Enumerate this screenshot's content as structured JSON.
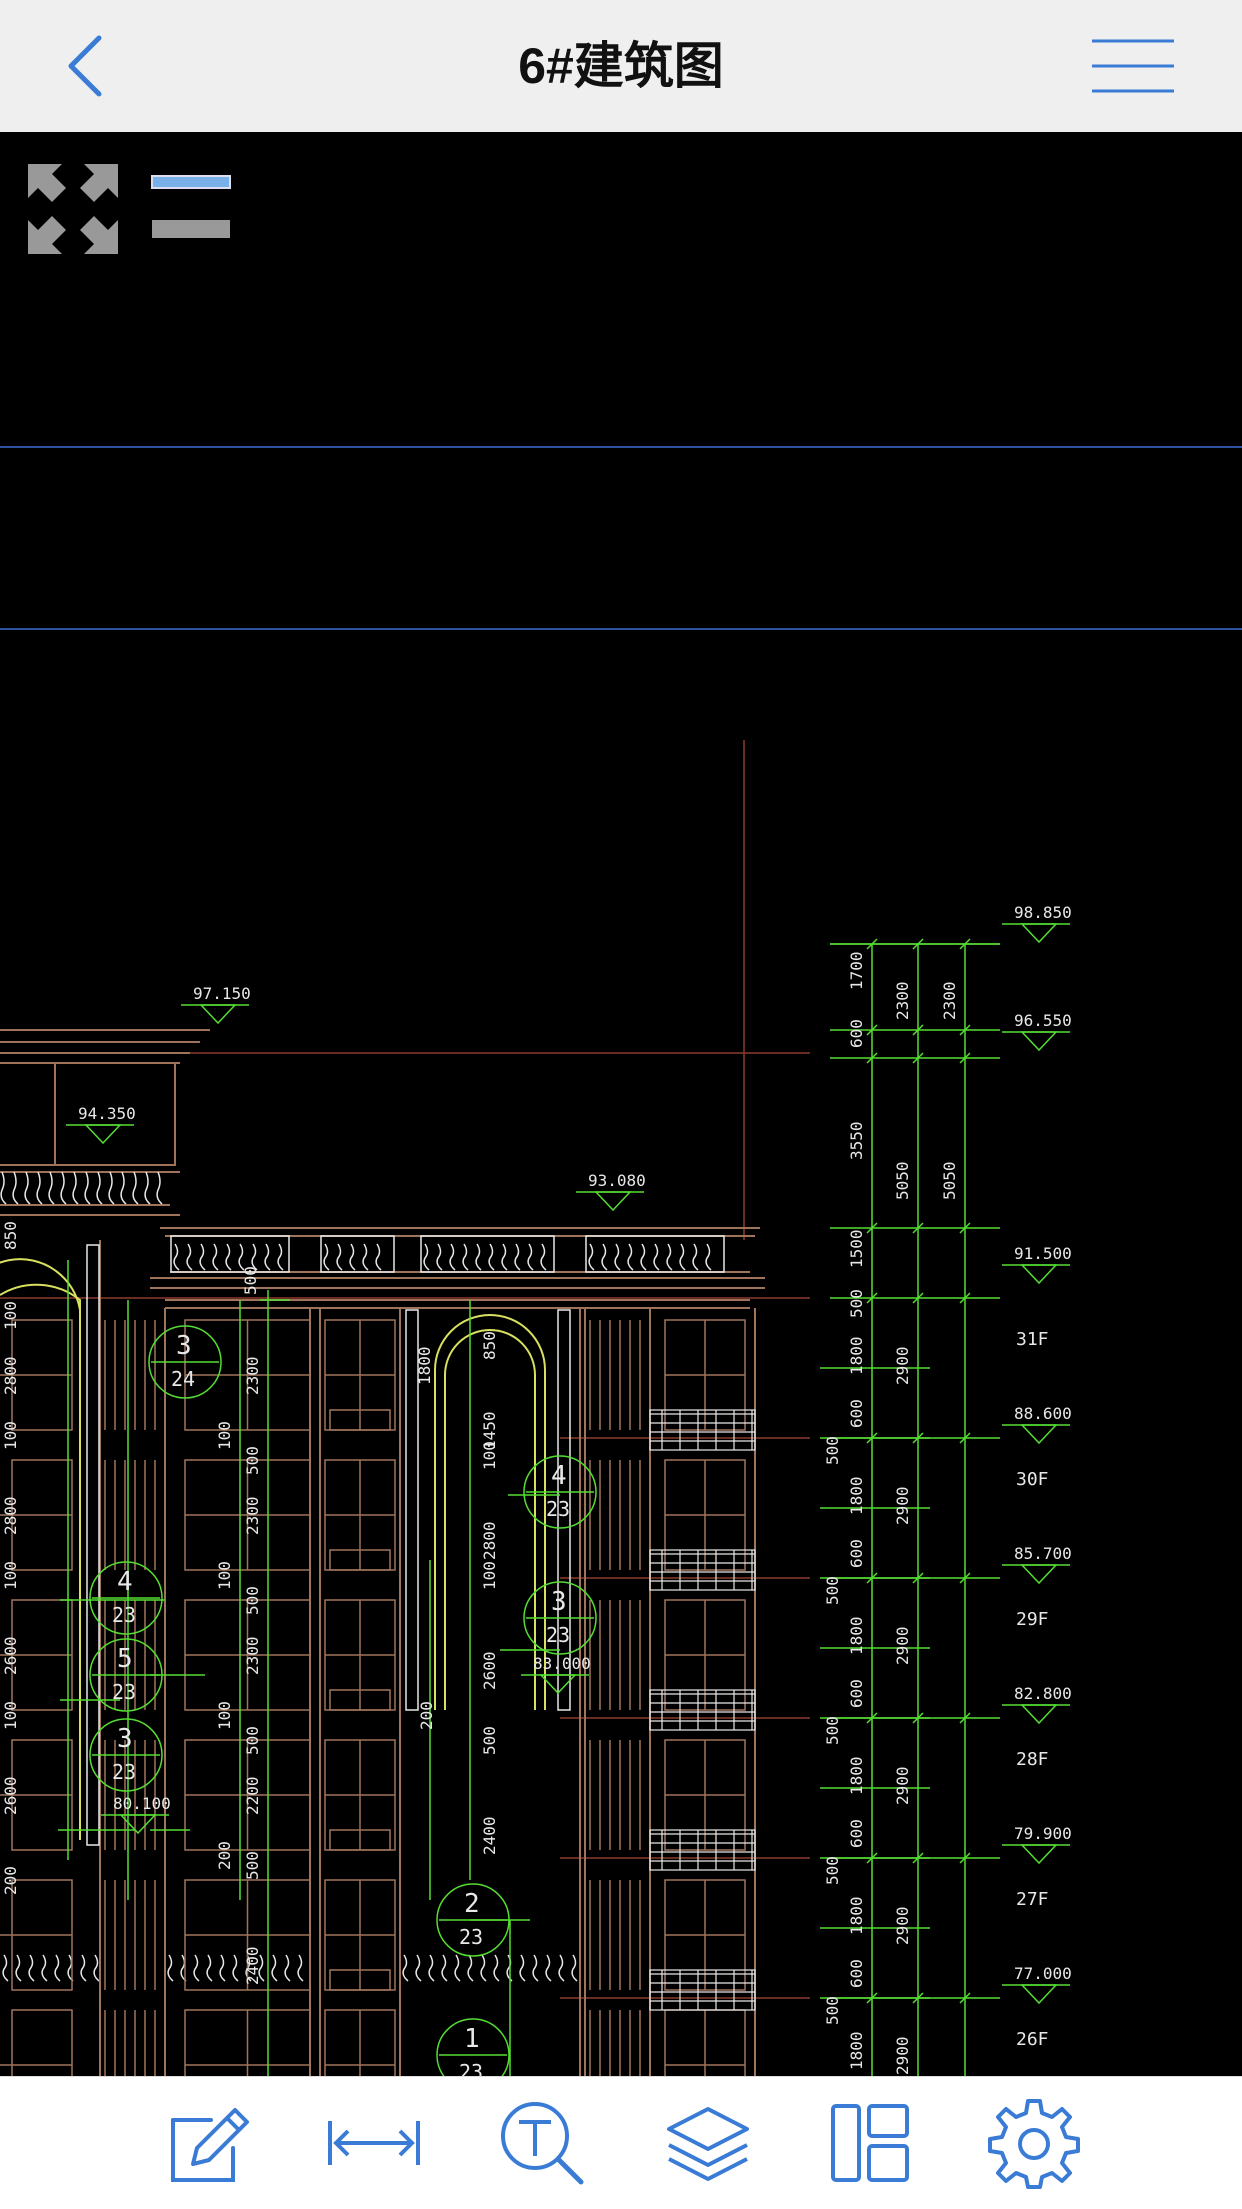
{
  "header": {
    "title": "6#建筑图",
    "back_icon": "chevron-left-icon",
    "menu_icon": "hamburger-menu-icon"
  },
  "overlay": {
    "fullscreen_icon": "expand-arrows-icon",
    "layers_icon": "layer-bars-icon"
  },
  "drawing": {
    "elevations": [
      "98.850",
      "97.150",
      "96.550",
      "94.350",
      "93.080",
      "91.500",
      "88.600",
      "85.700",
      "83.000",
      "82.800",
      "80.100",
      "79.900",
      "77.000"
    ],
    "floors": [
      "31F",
      "30F",
      "29F",
      "28F",
      "27F",
      "26F"
    ],
    "dims_col1": [
      "1700",
      "600",
      "3550",
      "1500",
      "500",
      "1800",
      "600",
      "1800",
      "600",
      "1800",
      "600",
      "1800",
      "600",
      "1800",
      "600",
      "1800"
    ],
    "dims_col2": [
      "2300",
      "5050",
      "2900",
      "2900",
      "2900",
      "2900",
      "2900",
      "2900"
    ],
    "dims_col3": [
      "2300",
      "5050"
    ],
    "dims_left": [
      "500",
      "500",
      "500",
      "500",
      "500"
    ],
    "building_dims_a": [
      "2300",
      "500",
      "2300",
      "500",
      "2300",
      "500",
      "2200",
      "500",
      "2400"
    ],
    "building_dims_b": [
      "850",
      "1450",
      "100",
      "2800",
      "100",
      "2600",
      "500",
      "2400"
    ],
    "building_dims_c": [
      "500",
      "100",
      "100",
      "100",
      "200"
    ],
    "building_dims_d": [
      "1800",
      "200"
    ],
    "callouts": [
      {
        "top": "3",
        "bottom": "24"
      },
      {
        "top": "4",
        "bottom": "23"
      },
      {
        "top": "3",
        "bottom": "23"
      },
      {
        "top": "4",
        "bottom": "23"
      },
      {
        "top": "5",
        "bottom": "23"
      },
      {
        "top": "3",
        "bottom": "23"
      },
      {
        "top": "2",
        "bottom": "23"
      },
      {
        "top": "1",
        "bottom": "23"
      }
    ],
    "left_edge_dims": [
      "850",
      "100",
      "2800",
      "100",
      "2800",
      "100",
      "2600",
      "100",
      "2600",
      "200"
    ]
  },
  "toolbar": {
    "items": [
      {
        "icon": "annotate-pencil-icon"
      },
      {
        "icon": "measure-distance-icon"
      },
      {
        "icon": "text-search-icon"
      },
      {
        "icon": "layers-icon"
      },
      {
        "icon": "layout-panels-icon"
      },
      {
        "icon": "settings-gear-icon"
      }
    ]
  },
  "colors": {
    "accent": "#3a7bd5",
    "cad_green": "#55dd33",
    "cad_yellow": "#d8e060",
    "cad_brown": "#a0745a",
    "cad_white": "#e8e8e8",
    "cad_red": "#8a3a2a",
    "guide_blue": "#3050a0"
  }
}
